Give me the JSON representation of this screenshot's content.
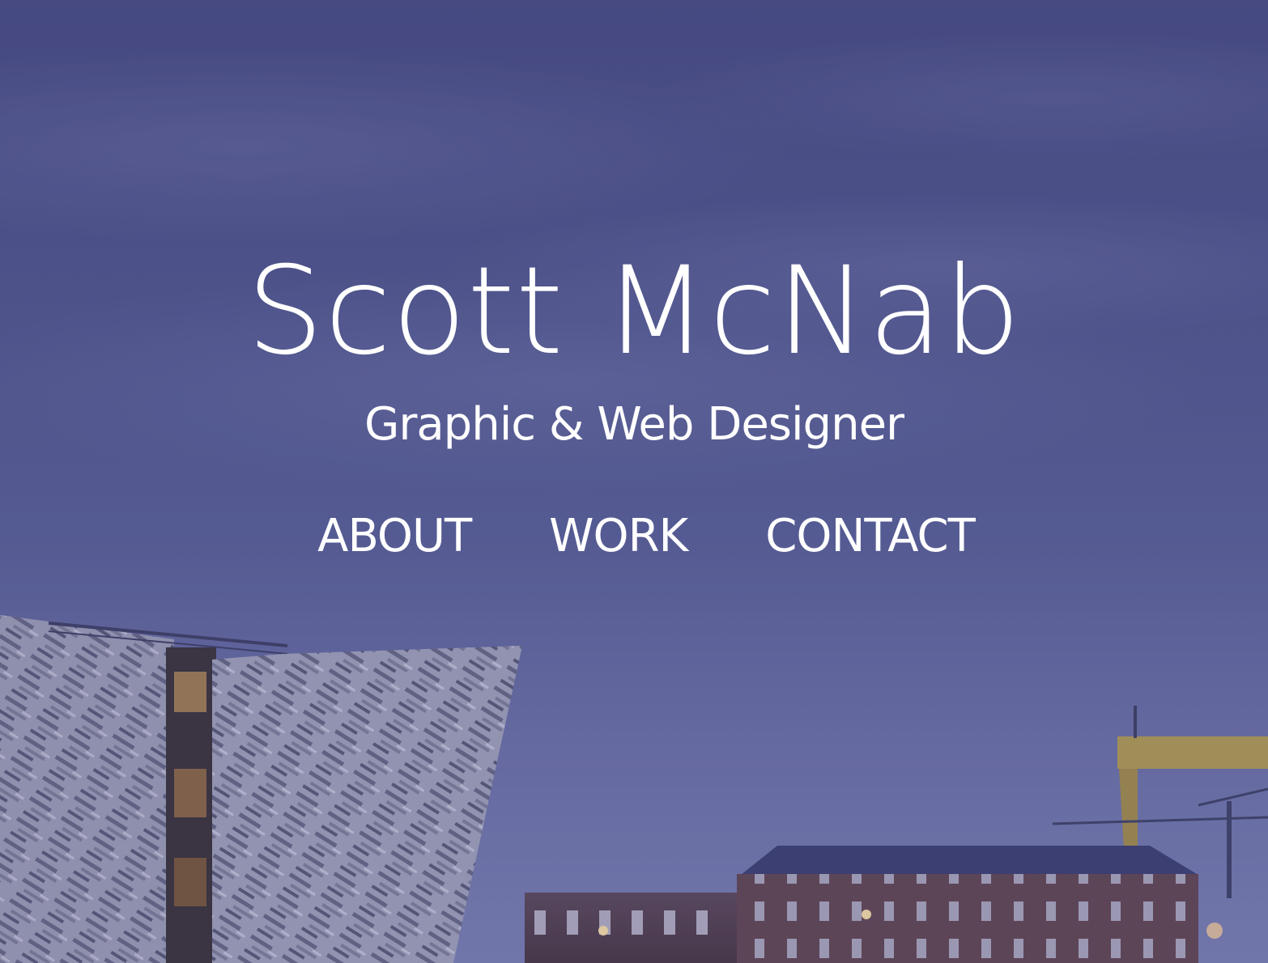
{
  "header": {
    "title": "Scott McNab",
    "tagline": "Graphic & Web Designer"
  },
  "nav": {
    "items": [
      {
        "label": "ABOUT"
      },
      {
        "label": "WORK"
      },
      {
        "label": "CONTACT"
      }
    ]
  },
  "colors": {
    "text": "#ffffff",
    "sky_overlay": "#4f5488"
  }
}
